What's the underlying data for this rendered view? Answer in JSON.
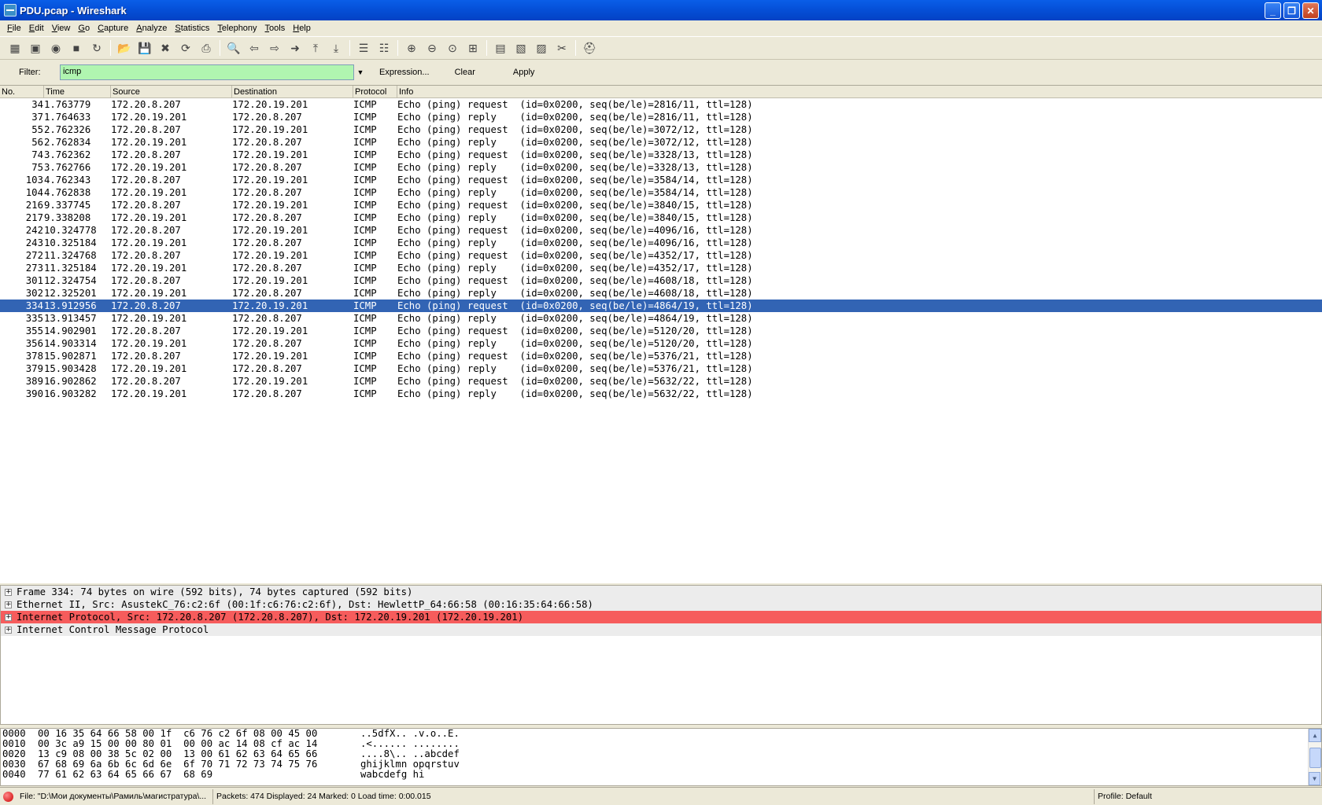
{
  "window": {
    "title": "PDU.pcap - Wireshark"
  },
  "menu": [
    "File",
    "Edit",
    "View",
    "Go",
    "Capture",
    "Analyze",
    "Statistics",
    "Telephony",
    "Tools",
    "Help"
  ],
  "toolbar": {
    "icons": [
      "interface-list-icon",
      "capture-options-icon",
      "start-capture-icon",
      "stop-capture-icon",
      "restart-capture-icon",
      "sep",
      "open-file-icon",
      "save-file-icon",
      "close-file-icon",
      "reload-icon",
      "print-icon",
      "sep",
      "find-packet-icon",
      "go-back-icon",
      "go-forward-icon",
      "go-to-packet-icon",
      "go-first-icon",
      "go-last-icon",
      "sep",
      "colorize-icon",
      "auto-scroll-icon",
      "sep",
      "zoom-in-icon",
      "zoom-out-icon",
      "zoom-normal-icon",
      "resize-columns-icon",
      "sep",
      "capture-filters-icon",
      "display-filters-icon",
      "coloring-rules-icon",
      "preferences-icon",
      "sep",
      "help-icon"
    ],
    "glyphs": [
      "▦",
      "▣",
      "◉",
      "■",
      "↻",
      "",
      "📂",
      "💾",
      "✖",
      "⟳",
      "⎙",
      "",
      "🔍",
      "⇦",
      "⇨",
      "➜",
      "⤒",
      "⤓",
      "",
      "☰",
      "☷",
      "",
      "⊕",
      "⊖",
      "⊙",
      "⊞",
      "",
      "▤",
      "▧",
      "▨",
      "✂",
      "",
      "⛑"
    ]
  },
  "filter": {
    "label": "Filter:",
    "value": "icmp",
    "expression": "Expression...",
    "clear": "Clear",
    "apply": "Apply"
  },
  "columns": [
    "No.",
    "Time",
    "Source",
    "Destination",
    "Protocol",
    "Info"
  ],
  "packets": [
    {
      "no": "34",
      "time": "1.763779",
      "src": "172.20.8.207",
      "dst": "172.20.19.201",
      "proto": "ICMP",
      "info": "Echo (ping) request  (id=0x0200, seq(be/le)=2816/11, ttl=128)"
    },
    {
      "no": "37",
      "time": "1.764633",
      "src": "172.20.19.201",
      "dst": "172.20.8.207",
      "proto": "ICMP",
      "info": "Echo (ping) reply    (id=0x0200, seq(be/le)=2816/11, ttl=128)"
    },
    {
      "no": "55",
      "time": "2.762326",
      "src": "172.20.8.207",
      "dst": "172.20.19.201",
      "proto": "ICMP",
      "info": "Echo (ping) request  (id=0x0200, seq(be/le)=3072/12, ttl=128)"
    },
    {
      "no": "56",
      "time": "2.762834",
      "src": "172.20.19.201",
      "dst": "172.20.8.207",
      "proto": "ICMP",
      "info": "Echo (ping) reply    (id=0x0200, seq(be/le)=3072/12, ttl=128)"
    },
    {
      "no": "74",
      "time": "3.762362",
      "src": "172.20.8.207",
      "dst": "172.20.19.201",
      "proto": "ICMP",
      "info": "Echo (ping) request  (id=0x0200, seq(be/le)=3328/13, ttl=128)"
    },
    {
      "no": "75",
      "time": "3.762766",
      "src": "172.20.19.201",
      "dst": "172.20.8.207",
      "proto": "ICMP",
      "info": "Echo (ping) reply    (id=0x0200, seq(be/le)=3328/13, ttl=128)"
    },
    {
      "no": "103",
      "time": "4.762343",
      "src": "172.20.8.207",
      "dst": "172.20.19.201",
      "proto": "ICMP",
      "info": "Echo (ping) request  (id=0x0200, seq(be/le)=3584/14, ttl=128)"
    },
    {
      "no": "104",
      "time": "4.762838",
      "src": "172.20.19.201",
      "dst": "172.20.8.207",
      "proto": "ICMP",
      "info": "Echo (ping) reply    (id=0x0200, seq(be/le)=3584/14, ttl=128)"
    },
    {
      "no": "216",
      "time": "9.337745",
      "src": "172.20.8.207",
      "dst": "172.20.19.201",
      "proto": "ICMP",
      "info": "Echo (ping) request  (id=0x0200, seq(be/le)=3840/15, ttl=128)"
    },
    {
      "no": "217",
      "time": "9.338208",
      "src": "172.20.19.201",
      "dst": "172.20.8.207",
      "proto": "ICMP",
      "info": "Echo (ping) reply    (id=0x0200, seq(be/le)=3840/15, ttl=128)"
    },
    {
      "no": "242",
      "time": "10.324778",
      "src": "172.20.8.207",
      "dst": "172.20.19.201",
      "proto": "ICMP",
      "info": "Echo (ping) request  (id=0x0200, seq(be/le)=4096/16, ttl=128)"
    },
    {
      "no": "243",
      "time": "10.325184",
      "src": "172.20.19.201",
      "dst": "172.20.8.207",
      "proto": "ICMP",
      "info": "Echo (ping) reply    (id=0x0200, seq(be/le)=4096/16, ttl=128)"
    },
    {
      "no": "272",
      "time": "11.324768",
      "src": "172.20.8.207",
      "dst": "172.20.19.201",
      "proto": "ICMP",
      "info": "Echo (ping) request  (id=0x0200, seq(be/le)=4352/17, ttl=128)"
    },
    {
      "no": "273",
      "time": "11.325184",
      "src": "172.20.19.201",
      "dst": "172.20.8.207",
      "proto": "ICMP",
      "info": "Echo (ping) reply    (id=0x0200, seq(be/le)=4352/17, ttl=128)"
    },
    {
      "no": "301",
      "time": "12.324754",
      "src": "172.20.8.207",
      "dst": "172.20.19.201",
      "proto": "ICMP",
      "info": "Echo (ping) request  (id=0x0200, seq(be/le)=4608/18, ttl=128)"
    },
    {
      "no": "302",
      "time": "12.325201",
      "src": "172.20.19.201",
      "dst": "172.20.8.207",
      "proto": "ICMP",
      "info": "Echo (ping) reply    (id=0x0200, seq(be/le)=4608/18, ttl=128)"
    },
    {
      "no": "334",
      "time": "13.912956",
      "src": "172.20.8.207",
      "dst": "172.20.19.201",
      "proto": "ICMP",
      "info": "Echo (ping) request  (id=0x0200, seq(be/le)=4864/19, ttl=128)",
      "selected": true
    },
    {
      "no": "335",
      "time": "13.913457",
      "src": "172.20.19.201",
      "dst": "172.20.8.207",
      "proto": "ICMP",
      "info": "Echo (ping) reply    (id=0x0200, seq(be/le)=4864/19, ttl=128)"
    },
    {
      "no": "355",
      "time": "14.902901",
      "src": "172.20.8.207",
      "dst": "172.20.19.201",
      "proto": "ICMP",
      "info": "Echo (ping) request  (id=0x0200, seq(be/le)=5120/20, ttl=128)"
    },
    {
      "no": "356",
      "time": "14.903314",
      "src": "172.20.19.201",
      "dst": "172.20.8.207",
      "proto": "ICMP",
      "info": "Echo (ping) reply    (id=0x0200, seq(be/le)=5120/20, ttl=128)"
    },
    {
      "no": "378",
      "time": "15.902871",
      "src": "172.20.8.207",
      "dst": "172.20.19.201",
      "proto": "ICMP",
      "info": "Echo (ping) request  (id=0x0200, seq(be/le)=5376/21, ttl=128)"
    },
    {
      "no": "379",
      "time": "15.903428",
      "src": "172.20.19.201",
      "dst": "172.20.8.207",
      "proto": "ICMP",
      "info": "Echo (ping) reply    (id=0x0200, seq(be/le)=5376/21, ttl=128)"
    },
    {
      "no": "389",
      "time": "16.902862",
      "src": "172.20.8.207",
      "dst": "172.20.19.201",
      "proto": "ICMP",
      "info": "Echo (ping) request  (id=0x0200, seq(be/le)=5632/22, ttl=128)"
    },
    {
      "no": "390",
      "time": "16.903282",
      "src": "172.20.19.201",
      "dst": "172.20.8.207",
      "proto": "ICMP",
      "info": "Echo (ping) reply    (id=0x0200, seq(be/le)=5632/22, ttl=128)"
    }
  ],
  "details": [
    {
      "text": "Frame 334: 74 bytes on wire (592 bits), 74 bytes captured (592 bits)"
    },
    {
      "text": "Ethernet II, Src: AsustekC_76:c2:6f (00:1f:c6:76:c2:6f), Dst: HewlettP_64:66:58 (00:16:35:64:66:58)"
    },
    {
      "text": "Internet Protocol, Src: 172.20.8.207 (172.20.8.207), Dst: 172.20.19.201 (172.20.19.201)",
      "highlight": true
    },
    {
      "text": "Internet Control Message Protocol"
    }
  ],
  "hex": [
    {
      "off": "0000",
      "hex": "00 16 35 64 66 58 00 1f  c6 76 c2 6f 08 00 45 00",
      "ascii": "..5dfX.. .v.o..E."
    },
    {
      "off": "0010",
      "hex": "00 3c a9 15 00 00 80 01  00 00 ac 14 08 cf ac 14",
      "ascii": ".<...... ........"
    },
    {
      "off": "0020",
      "hex": "13 c9 08 00 38 5c 02 00  13 00 61 62 63 64 65 66",
      "ascii": "....8\\.. ..abcdef"
    },
    {
      "off": "0030",
      "hex": "67 68 69 6a 6b 6c 6d 6e  6f 70 71 72 73 74 75 76",
      "ascii": "ghijklmn opqrstuv"
    },
    {
      "off": "0040",
      "hex": "77 61 62 63 64 65 66 67  68 69",
      "ascii": "wabcdefg hi"
    }
  ],
  "status": {
    "file": "File: \"D:\\Мои документы\\Рамиль\\магистратура\\...",
    "packets": "Packets: 474 Displayed: 24 Marked: 0 Load time: 0:00.015",
    "profile": "Profile: Default"
  },
  "colors": {
    "selected_row": "#3264b4",
    "filter_ok": "#b0f5b0",
    "detail_highlight": "#f65c5c",
    "titlebar": "#0550d8"
  }
}
